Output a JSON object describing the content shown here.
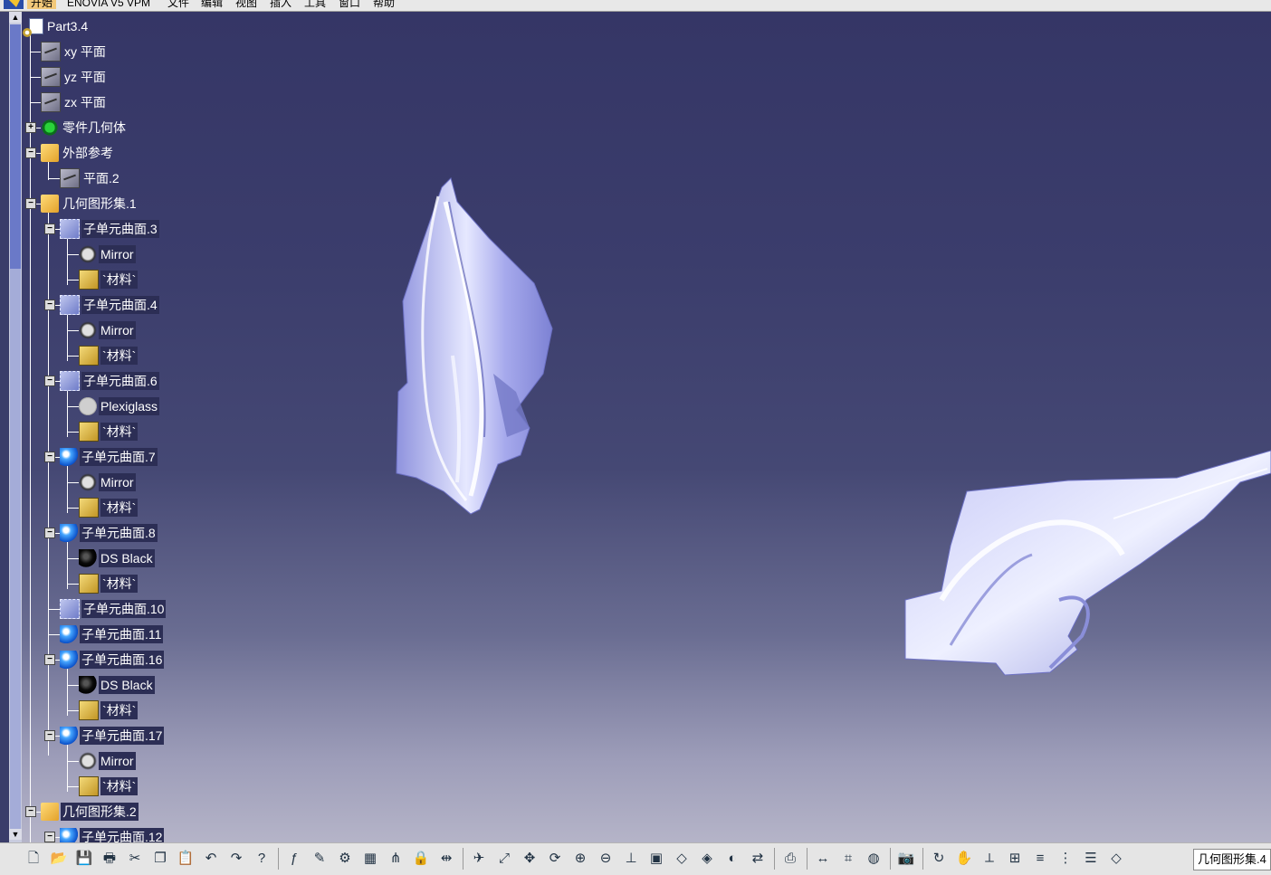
{
  "menubar": {
    "items": [
      "开始",
      "ENOVIA V5 VPM",
      "文件",
      "编辑",
      "视图",
      "插入",
      "工具",
      "窗口",
      "帮助"
    ]
  },
  "tree": {
    "root": "Part3.4",
    "nodes": [
      {
        "label": "xy 平面",
        "icon": "plane-icon"
      },
      {
        "label": "yz 平面",
        "icon": "plane-icon"
      },
      {
        "label": "zx 平面",
        "icon": "plane-icon"
      },
      {
        "label": "零件几何体",
        "icon": "body-gear-icon"
      },
      {
        "label": "外部参考",
        "icon": "external-reference-icon"
      },
      {
        "label": "平面.2",
        "icon": "plane-icon"
      },
      {
        "label": "几何图形集.1",
        "icon": "geometrical-set-icon"
      },
      {
        "label": "子单元曲面.3",
        "icon": "subdivision-surface-icon"
      },
      {
        "label": "Mirror",
        "icon": "mirror-material-icon"
      },
      {
        "label": "`材料`",
        "icon": "material-icon"
      },
      {
        "label": "子单元曲面.4",
        "icon": "subdivision-surface-icon"
      },
      {
        "label": "Mirror",
        "icon": "mirror-material-icon"
      },
      {
        "label": "`材料`",
        "icon": "material-icon"
      },
      {
        "label": "子单元曲面.6",
        "icon": "subdivision-surface-icon"
      },
      {
        "label": "Plexiglass",
        "icon": "plexiglass-material-icon"
      },
      {
        "label": "`材料`",
        "icon": "material-icon"
      },
      {
        "label": "子单元曲面.7",
        "icon": "subdivision-surface-ball-icon"
      },
      {
        "label": "Mirror",
        "icon": "mirror-material-icon"
      },
      {
        "label": "`材料`",
        "icon": "material-icon"
      },
      {
        "label": "子单元曲面.8",
        "icon": "subdivision-surface-ball-icon"
      },
      {
        "label": "DS Black",
        "icon": "black-material-icon"
      },
      {
        "label": "`材料`",
        "icon": "material-icon"
      },
      {
        "label": "子单元曲面.10",
        "icon": "subdivision-surface-icon"
      },
      {
        "label": "子单元曲面.11",
        "icon": "subdivision-surface-ball-icon"
      },
      {
        "label": "子单元曲面.16",
        "icon": "subdivision-surface-ball-icon"
      },
      {
        "label": "DS Black",
        "icon": "black-material-icon"
      },
      {
        "label": "`材料`",
        "icon": "material-icon"
      },
      {
        "label": "子单元曲面.17",
        "icon": "subdivision-surface-ball-icon"
      },
      {
        "label": "Mirror",
        "icon": "mirror-material-icon"
      },
      {
        "label": "`材料`",
        "icon": "material-icon"
      },
      {
        "label": "几何图形集.2",
        "icon": "geometrical-set-icon"
      },
      {
        "label": "子单元曲面.12",
        "icon": "subdivision-surface-ball-icon"
      }
    ]
  },
  "toolbar": {
    "buttons": [
      "new-icon",
      "open-icon",
      "save-icon",
      "print-icon",
      "cut-icon",
      "copy-icon",
      "paste-icon",
      "undo-icon",
      "redo-icon",
      "whats-this-icon",
      "formula-icon",
      "comment-icon",
      "knowledge-icon",
      "table-icon",
      "graph-icon",
      "lock-icon",
      "split-icon",
      "fly-icon",
      "fit-all-icon",
      "pan-icon",
      "rotate-icon",
      "zoom-in-icon",
      "zoom-out-icon",
      "normal-view-icon",
      "multi-view-icon",
      "iso-view-icon",
      "shading-icon",
      "hide-show-icon",
      "swap-icon",
      "capture-icon",
      "measure-icon",
      "analysis-icon",
      "material-apply-icon",
      "camera-icon",
      "refresh-icon",
      "manipulate-icon",
      "axis-icon",
      "grid-icon",
      "layer-icon",
      "tree-icon",
      "list-icon",
      "geometry-set-icon"
    ],
    "current_set": "几何图形集.4"
  },
  "colors": {
    "viewport_top": "#353666",
    "viewport_bottom": "#b5b4c8",
    "surface": "#a9ace8",
    "tree_label_bg": "#2c2e55"
  }
}
